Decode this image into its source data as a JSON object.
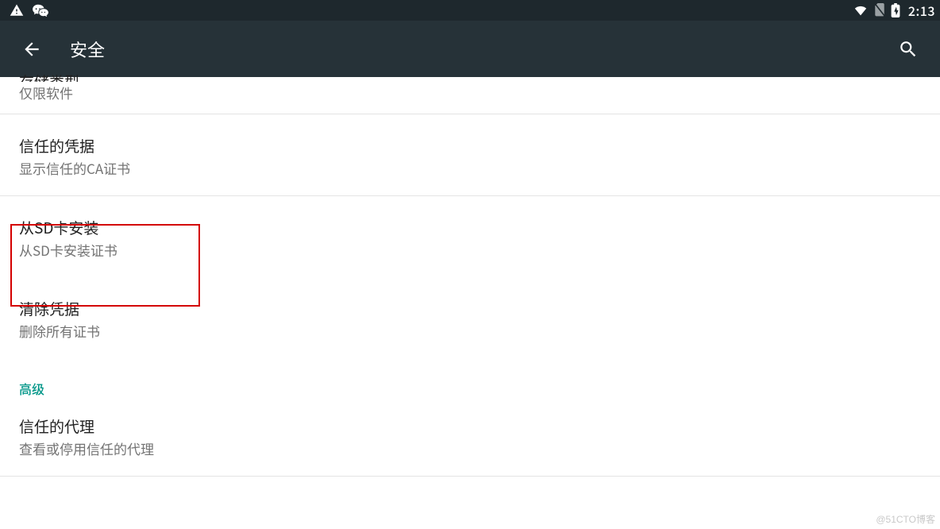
{
  "status": {
    "time": "2:13"
  },
  "appbar": {
    "title": "安全"
  },
  "items": {
    "storage": {
      "title": "存储类型",
      "sub": "仅限软件"
    },
    "trusted": {
      "title": "信任的凭据",
      "sub": "显示信任的CA证书"
    },
    "install": {
      "title": "从SD卡安装",
      "sub": "从SD卡安装证书"
    },
    "clear": {
      "title": "清除凭据",
      "sub": "删除所有证书"
    },
    "agents": {
      "title": "信任的代理",
      "sub": "查看或停用信任的代理"
    }
  },
  "section": {
    "advanced": "高级"
  },
  "watermark": "@51CTO博客"
}
